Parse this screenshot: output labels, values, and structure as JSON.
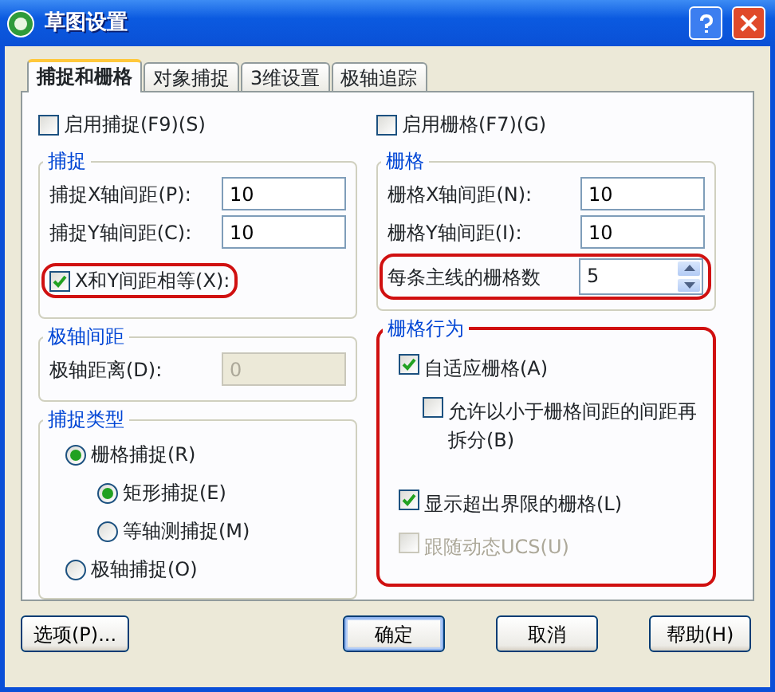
{
  "window": {
    "title": "草图设置"
  },
  "tabs": [
    {
      "label": "捕捉和栅格",
      "selected": true
    },
    {
      "label": "对象捕捉",
      "selected": false
    },
    {
      "label": "3维设置",
      "selected": false
    },
    {
      "label": "极轴追踪",
      "selected": false
    }
  ],
  "snap_enable": {
    "label": "启用捕捉(F9)(S)",
    "checked": false
  },
  "grid_enable": {
    "label": "启用栅格(F7)(G)",
    "checked": false
  },
  "snap": {
    "title": "捕捉",
    "fields": [
      {
        "label": "捕捉X轴间距(P):",
        "value": "10"
      },
      {
        "label": "捕捉Y轴间距(C):",
        "value": "10"
      }
    ],
    "equal": {
      "label": "X和Y间距相等(X):",
      "checked": true,
      "highlighted": true
    }
  },
  "polar": {
    "title": "极轴间距",
    "field": {
      "label": "极轴距离(D):",
      "value": "0",
      "disabled": true
    }
  },
  "snap_type": {
    "title": "捕捉类型",
    "options": [
      {
        "label": "栅格捕捉(R)",
        "selected": true,
        "children": [
          {
            "label": "矩形捕捉(E)",
            "selected": true
          },
          {
            "label": "等轴测捕捉(M)",
            "selected": false
          }
        ]
      },
      {
        "label": "极轴捕捉(O)",
        "selected": false
      }
    ]
  },
  "grid": {
    "title": "栅格",
    "fields": [
      {
        "label": "栅格X轴间距(N):",
        "value": "10"
      },
      {
        "label": "栅格Y轴间距(I):",
        "value": "10"
      }
    ],
    "major": {
      "label": "每条主线的栅格数",
      "value": "5",
      "highlighted": true
    }
  },
  "grid_behavior": {
    "title": "栅格行为",
    "highlighted": true,
    "options": [
      {
        "label": "自适应栅格(A)",
        "checked": true,
        "disabled": false,
        "children": [
          {
            "label": "允许以小于栅格间距的间距再拆分(B)",
            "checked": false,
            "disabled": false
          }
        ]
      },
      {
        "label": "显示超出界限的栅格(L)",
        "checked": true,
        "disabled": false
      },
      {
        "label": "跟随动态UCS(U)",
        "checked": false,
        "disabled": true
      }
    ]
  },
  "buttons": [
    {
      "label": "选项(P)...",
      "default": false
    },
    {
      "label": "确定",
      "default": true
    },
    {
      "label": "取消",
      "default": false
    },
    {
      "label": "帮助(H)",
      "default": false
    }
  ]
}
